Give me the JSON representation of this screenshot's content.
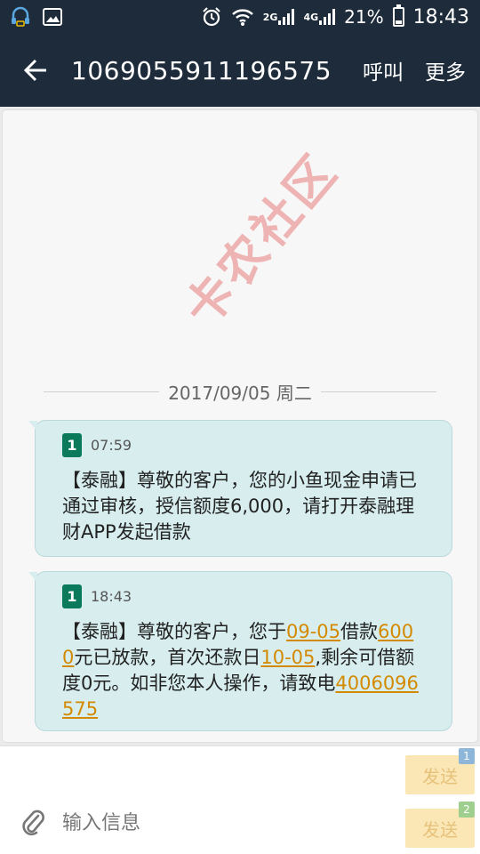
{
  "status_bar": {
    "battery": "21%",
    "time": "18:43",
    "net1": "2G",
    "net2": "4G"
  },
  "app_bar": {
    "title": "1069055911196575",
    "call_label": "呼叫",
    "more_label": "更多"
  },
  "conversation": {
    "date": "2017/09/05 周二",
    "messages": [
      {
        "sim": "1",
        "time": "07:59",
        "text": "【泰融】尊敬的客户，您的小鱼现金申请已通过审核，授信额度6,000，请打开泰融理财APP发起借款"
      },
      {
        "sim": "1",
        "time": "18:43",
        "seg1": "【泰融】尊敬的客户，您于",
        "link1": "09-05",
        "seg2": "借款",
        "link2": "6000",
        "seg3": "元已放款，首次还款日",
        "link3": "10-05",
        "seg4": ",剩余可借额度0元。如非您本人操作，请致电",
        "link4": "4006096575"
      }
    ]
  },
  "watermark": "卡农社区",
  "input": {
    "placeholder": "输入信息"
  },
  "send": {
    "label1": "发送",
    "sim1": "1",
    "label2": "发送",
    "sim2": "2"
  },
  "colors": {
    "header_bg": "#1d2b3a",
    "bubble_bg": "#d7edee",
    "link": "#d48a00",
    "send_bg": "#fbe6b6"
  }
}
